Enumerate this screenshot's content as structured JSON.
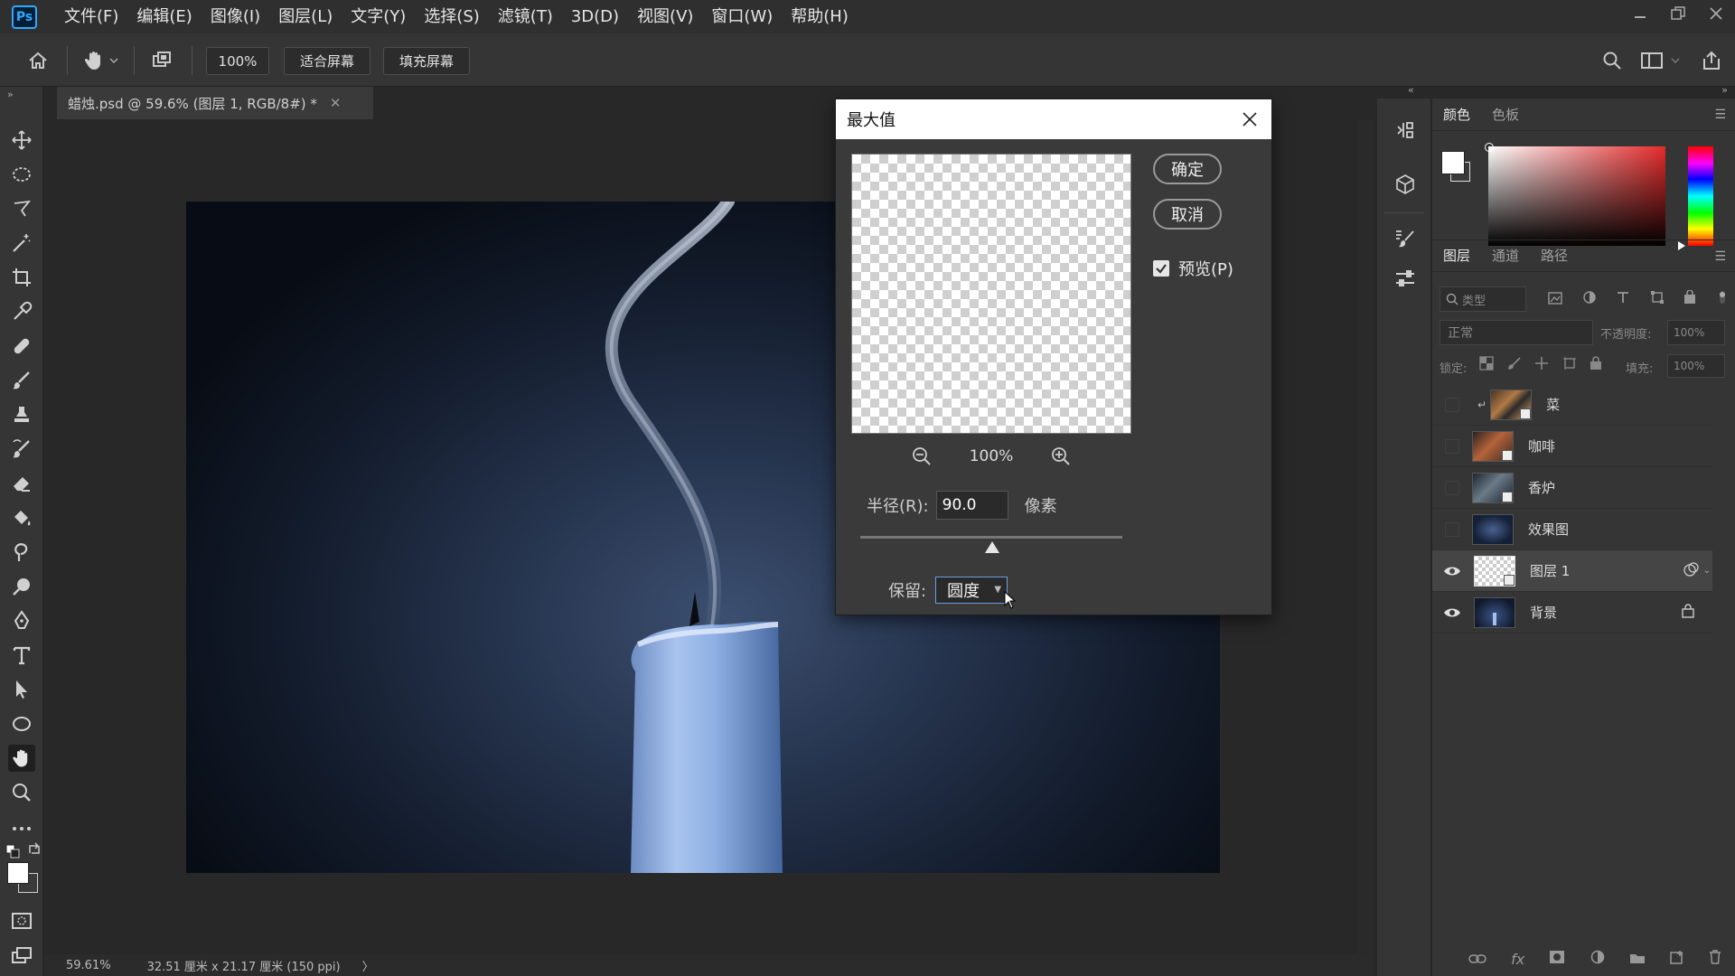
{
  "app": {
    "logo": "Ps",
    "menu": [
      "文件(F)",
      "编辑(E)",
      "图像(I)",
      "图层(L)",
      "文字(Y)",
      "选择(S)",
      "滤镜(T)",
      "3D(D)",
      "视图(V)",
      "窗口(W)",
      "帮助(H)"
    ]
  },
  "options_bar": {
    "zoom": "100%",
    "fit_screen": "适合屏幕",
    "fill_screen": "填充屏幕"
  },
  "document": {
    "tab_title": "蜡烛.psd @ 59.6% (图层 1, RGB/8#) *",
    "close_glyph": "✕"
  },
  "status": {
    "zoom": "59.61%",
    "doc_info": "32.51 厘米 x 21.17 厘米 (150 ppi)",
    "arrow": "〉"
  },
  "dialog": {
    "title": "最大值",
    "ok": "确定",
    "cancel": "取消",
    "preview_label": "预览(P)",
    "preview_checked": true,
    "zoom": "100%",
    "radius_label": "半径(R):",
    "radius_value": "90.0",
    "radius_unit": "像素",
    "preserve_label": "保留:",
    "preserve_value": "圆度"
  },
  "color_panel": {
    "tabs": [
      "颜色",
      "色板"
    ],
    "foreground": "#ffffff",
    "background": "#3a3a3a"
  },
  "layers_panel": {
    "tabs": [
      "图层",
      "通道",
      "路径"
    ],
    "filter_placeholder": "类型",
    "blend_mode": "正常",
    "opacity_label": "不透明度:",
    "opacity_value": "100%",
    "lock_label": "锁定:",
    "fill_label": "填充:",
    "fill_value": "100%",
    "layers": [
      {
        "name": "菜",
        "visible": false,
        "clipped": true
      },
      {
        "name": "咖啡",
        "visible": false,
        "clipped": false
      },
      {
        "name": "香炉",
        "visible": false,
        "clipped": false
      },
      {
        "name": "效果图",
        "visible": false,
        "clipped": false
      },
      {
        "name": "图层 1",
        "visible": true,
        "selected": true
      },
      {
        "name": "背景",
        "visible": true,
        "locked": true
      }
    ]
  }
}
